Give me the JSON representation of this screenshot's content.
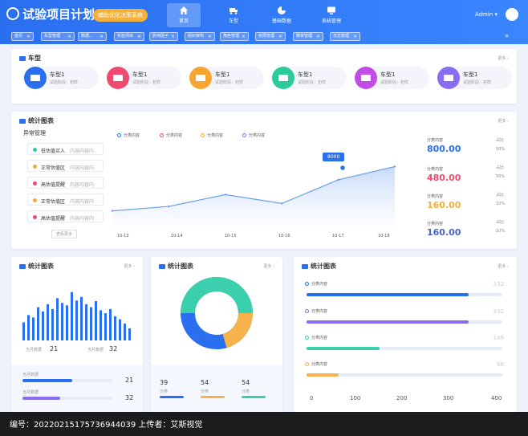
{
  "header": {
    "title": "试验项目计划",
    "badge": "辅助优化决策系统",
    "nav": [
      {
        "label": "首页",
        "icon": "home-icon",
        "active": true
      },
      {
        "label": "车型",
        "icon": "truck-icon",
        "active": false
      },
      {
        "label": "基础数据",
        "icon": "pie-icon",
        "active": false
      },
      {
        "label": "系统管理",
        "icon": "monitor-icon",
        "active": false
      }
    ],
    "user": "Admin"
  },
  "tags": [
    "首页",
    "车型管理",
    "数据...",
    "实验项目",
    "影响因子",
    "组织架构",
    "角色管理",
    "权限管理",
    "菜单管理",
    "日志管理"
  ],
  "car_card": {
    "title": "车型",
    "more": "更多",
    "items": [
      {
        "name": "车型1",
        "sub": "试验阶段：初样",
        "color": "#2a6ff0"
      },
      {
        "name": "车型1",
        "sub": "试验阶段：初样",
        "color": "#ef4b6e"
      },
      {
        "name": "车型1",
        "sub": "试验阶段：初样",
        "color": "#f7a632"
      },
      {
        "name": "车型1",
        "sub": "试验阶段：初样",
        "color": "#2ccb9b"
      },
      {
        "name": "车型1",
        "sub": "试验阶段：初样",
        "color": "#c44ce6"
      },
      {
        "name": "车型1",
        "sub": "试验阶段：初样",
        "color": "#8a6cf0"
      }
    ]
  },
  "stats_card": {
    "title": "统计图表",
    "more": "更多",
    "alert_title": "异常管理",
    "alerts": [
      {
        "name": "低估值买入",
        "content": "内容内容内",
        "color": "#2ccb9b"
      },
      {
        "name": "正常估值区",
        "content": "内容内容内",
        "color": "#f7a632"
      },
      {
        "name": "高估值提醒",
        "content": "内容内容内",
        "color": "#ef4b6e"
      },
      {
        "name": "正常估值区",
        "content": "内容内容内",
        "color": "#f7a632"
      },
      {
        "name": "高估值提醒",
        "content": "内容内容内",
        "color": "#ef4b6e"
      }
    ],
    "alert_more": "查看更多",
    "tooltip": "8000",
    "stats": [
      {
        "label": "分类内容",
        "value": "800.00",
        "pct_label": "占比",
        "pct": "50%",
        "color": "#2a6ff0"
      },
      {
        "label": "分类内容",
        "value": "480.00",
        "pct_label": "占比",
        "pct": "50%",
        "color": "#ef4b6e"
      },
      {
        "label": "分类内容",
        "value": "160.00",
        "pct_label": "占比",
        "pct": "10%",
        "color": "#f3b13b"
      },
      {
        "label": "分类内容",
        "value": "160.00",
        "pct_label": "占比",
        "pct": "10%",
        "color": "#4b63c9"
      }
    ]
  },
  "bar_card": {
    "title": "统计图表",
    "more": "更多",
    "month_label": "当月数据",
    "month_value": "21",
    "last_label": "当月数据",
    "last_value": "32",
    "rows": [
      {
        "label": "当月数据",
        "value": "21",
        "fraction": 0.55,
        "color": "#2a6ff0"
      },
      {
        "label": "当月数据",
        "value": "32",
        "fraction": 0.42,
        "color": "#8a6cf0"
      }
    ]
  },
  "donut_card": {
    "title": "统计图表",
    "more": "更多",
    "items": [
      {
        "value": "39",
        "label": "分类",
        "color": "#2a6ff0"
      },
      {
        "value": "54",
        "label": "分类",
        "color": "#f7b34b"
      },
      {
        "value": "54",
        "label": "分类",
        "color": "#3ccfae"
      }
    ]
  },
  "progress_card": {
    "title": "统计图表",
    "more": "更多",
    "rows": [
      {
        "name": "分类内容",
        "value": 332,
        "color": "#2a6ff0"
      },
      {
        "name": "分类内容",
        "value": 332,
        "color": "#8a6cf0"
      },
      {
        "name": "分类内容",
        "value": 149,
        "color": "#3ccfae"
      },
      {
        "name": "分类内容",
        "value": 66,
        "color": "#f7b34b"
      }
    ],
    "axis": [
      "0",
      "100",
      "200",
      "300",
      "400"
    ]
  },
  "footer": {
    "text": "编号：20220215175736944039 上传者：艾斯视觉"
  },
  "chart_data": [
    {
      "type": "area",
      "x": [
        "10-13",
        "10-14",
        "10-15",
        "10-16",
        "10-17",
        "10-18"
      ],
      "series": [
        {
          "values": [
            2000,
            2600,
            4200,
            3000,
            6200,
            8000
          ]
        }
      ],
      "legend": [
        "分类内容",
        "分类内容",
        "分类内容",
        "分类内容"
      ],
      "annotations": [
        "8000"
      ]
    },
    {
      "type": "bar",
      "series": [
        {
          "values": [
            30,
            42,
            38,
            55,
            48,
            60,
            52,
            70,
            62,
            58,
            80,
            66,
            72,
            60,
            55,
            65,
            50,
            45,
            52,
            40,
            35,
            28,
            20
          ]
        }
      ]
    }
  ]
}
